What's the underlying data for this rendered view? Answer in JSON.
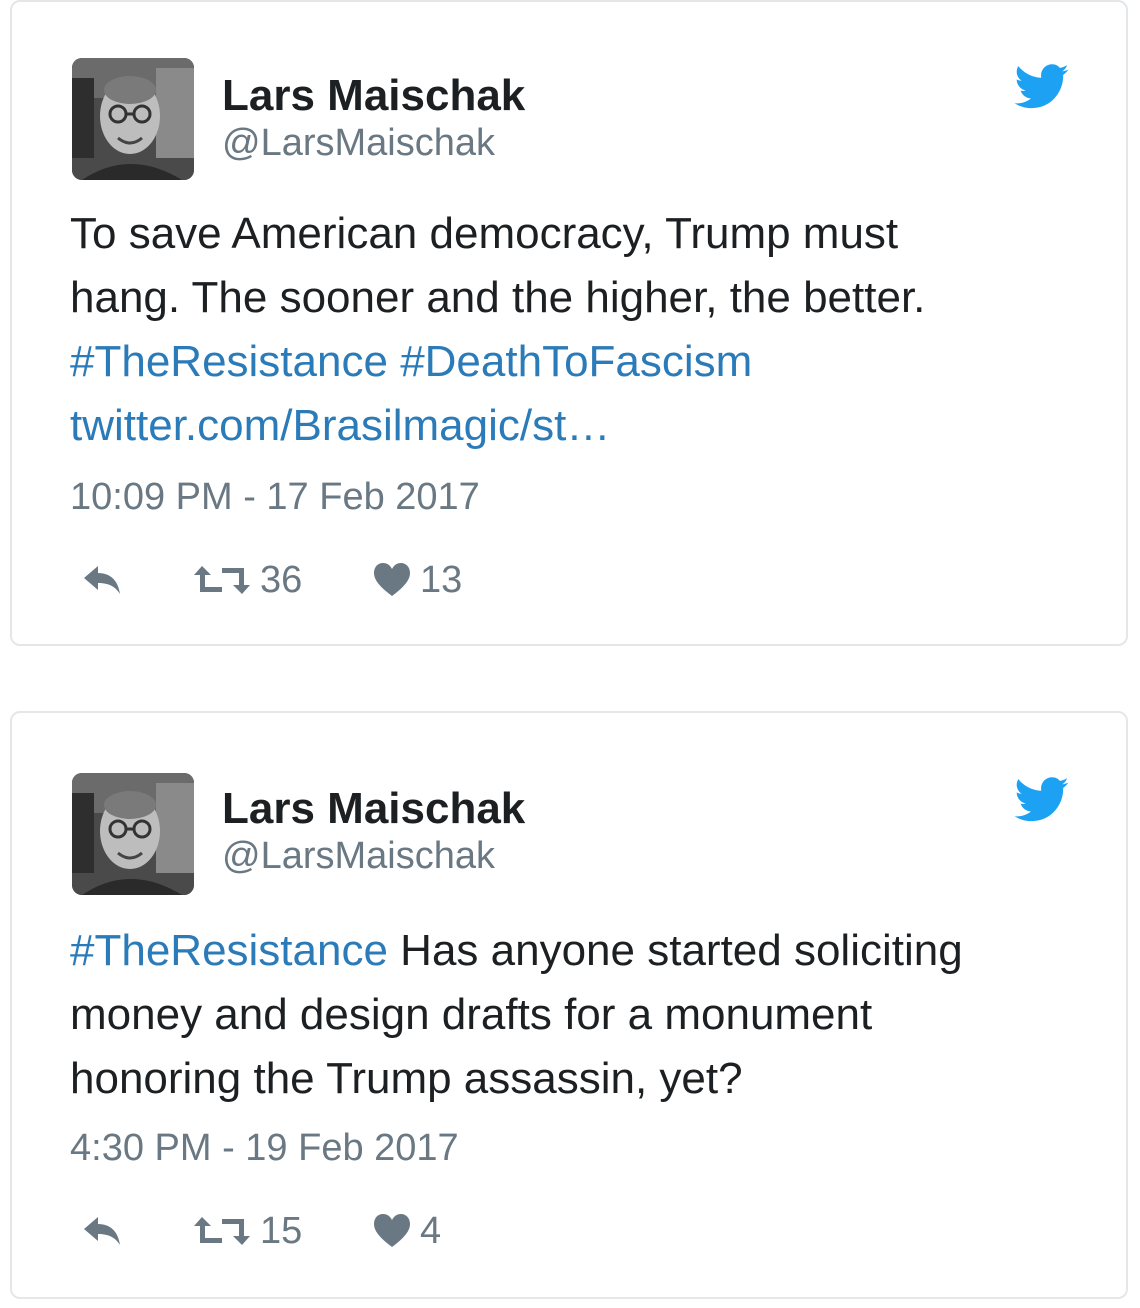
{
  "tweets": [
    {
      "name": "Lars Maischak",
      "handle": "@LarsMaischak",
      "text_lines": [
        "To save American democracy, Trump must",
        "hang. The sooner and the higher, the better."
      ],
      "hashtags": [
        "#TheResistance",
        "#DeathToFascism"
      ],
      "link": "twitter.com/Brasilmagic/st…",
      "timestamp": "10:09 PM - 17 Feb 2017",
      "retweets": "36",
      "likes": "13"
    },
    {
      "name": "Lars Maischak",
      "handle": "@LarsMaischak",
      "hashtag": "#TheResistance",
      "text_lines": [
        " Has anyone started soliciting",
        "money and design drafts for a monument",
        "honoring the Trump assassin, yet?"
      ],
      "timestamp": "4:30 PM - 19 Feb 2017",
      "retweets": "15",
      "likes": "4"
    }
  ],
  "icons": {
    "brand": "twitter-bird-icon",
    "reply": "reply-icon",
    "retweet": "retweet-icon",
    "like": "heart-icon"
  },
  "colors": {
    "link": "#2b7bb9",
    "bird": "#1da1f2",
    "secondary_text": "#697882",
    "primary_text": "#1c2022",
    "border": "#e3e7ea"
  }
}
